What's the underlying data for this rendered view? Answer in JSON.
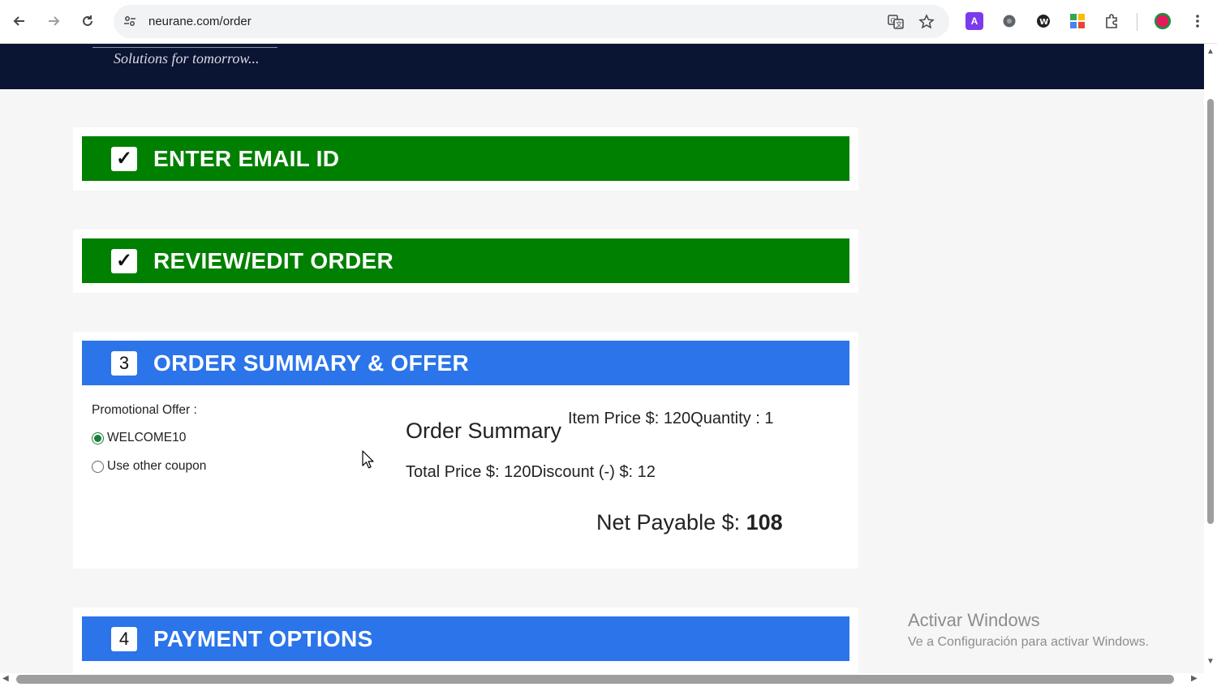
{
  "browser": {
    "url": "neurane.com/order",
    "icons": {
      "back": "back-arrow-icon",
      "forward": "forward-arrow-icon",
      "reload": "reload-icon",
      "site_settings": "tune-icon",
      "translate": "translate-icon",
      "bookmark": "star-icon",
      "extensions": "puzzle-icon",
      "menu": "kebab-menu-icon"
    }
  },
  "header": {
    "tagline": "Solutions for tomorrow..."
  },
  "steps": [
    {
      "marker": "✓",
      "title": "ENTER EMAIL ID",
      "state": "complete",
      "color": "#008000"
    },
    {
      "marker": "✓",
      "title": "REVIEW/EDIT ORDER",
      "state": "complete",
      "color": "#008000"
    },
    {
      "marker": "3",
      "title": "ORDER SUMMARY & OFFER",
      "state": "active",
      "color": "#2b74ea"
    },
    {
      "marker": "4",
      "title": "PAYMENT OPTIONS",
      "state": "pending",
      "color": "#2b74ea"
    }
  ],
  "offer": {
    "label": "Promotional Offer :",
    "options": [
      {
        "label": "WELCOME10",
        "selected": true
      },
      {
        "label": "Use other coupon",
        "selected": false
      }
    ]
  },
  "summary": {
    "title": "Order Summary",
    "item_line": "Item Price $: 120Quantity : 1",
    "total_line": "Total Price $: 120Discount (-) $: 12",
    "net_label": "Net Payable $: ",
    "net_value": "108"
  },
  "watermark": {
    "line1": "Activar Windows",
    "line2": "Ve a Configuración para activar Windows."
  }
}
